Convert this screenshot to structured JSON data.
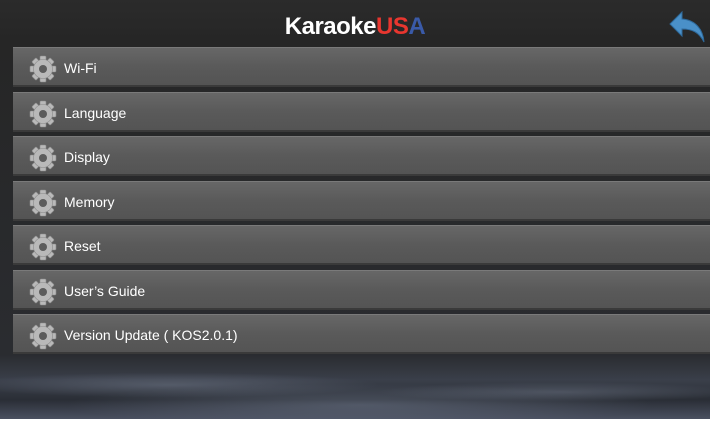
{
  "header": {
    "logo_part1": "Karaoke",
    "logo_part2": "US",
    "logo_part3": "A"
  },
  "back_icon": "back-arrow-icon",
  "gear_icon": "gear-icon",
  "colors": {
    "logo_red": "#e8362f",
    "logo_blue": "#3a5aa8",
    "back_arrow": "#4a90c8"
  },
  "menu": {
    "items": [
      {
        "label": "Wi-Fi"
      },
      {
        "label": "Language"
      },
      {
        "label": "Display"
      },
      {
        "label": "Memory"
      },
      {
        "label": "Reset"
      },
      {
        "label": "User’s Guide"
      },
      {
        "label": "Version Update ( KOS2.0.1)"
      }
    ]
  }
}
